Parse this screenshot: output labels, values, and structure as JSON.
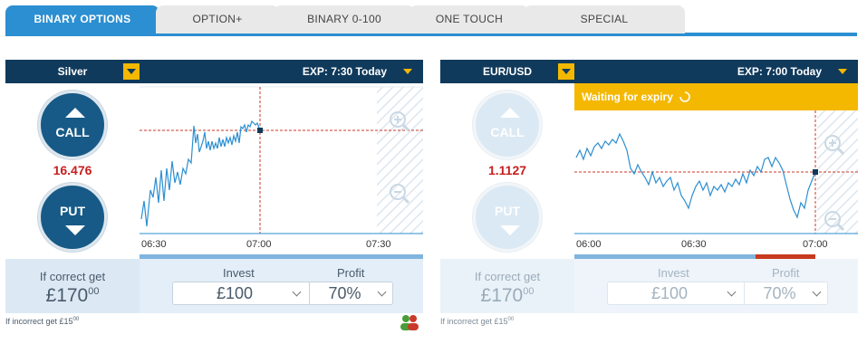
{
  "tabs": [
    {
      "label": "BINARY OPTIONS",
      "active": true
    },
    {
      "label": "OPTION+",
      "active": false
    },
    {
      "label": "BINARY 0-100",
      "active": false
    },
    {
      "label": "ONE TOUCH",
      "active": false
    },
    {
      "label": "SPECIAL",
      "active": false
    }
  ],
  "panels": [
    {
      "asset": "Silver",
      "expiry": "EXP: 7:30 Today",
      "call_label": "CALL",
      "put_label": "PUT",
      "price": "16.476",
      "status": "",
      "x_ticks": [
        "06:30",
        "07:00",
        "07:30"
      ],
      "if_correct_label": "If correct get",
      "if_correct_amount": "£170",
      "if_correct_pence": "00",
      "invest_label": "Invest",
      "invest_value": "£100",
      "profit_label": "Profit",
      "profit_value": "70%",
      "incorrect_text": "If incorrect get £15",
      "incorrect_pence": "00"
    },
    {
      "asset": "EUR/USD",
      "expiry": "EXP: 7:00 Today",
      "call_label": "CALL",
      "put_label": "PUT",
      "price": "1.1127",
      "status": "Waiting for expiry",
      "x_ticks": [
        "06:00",
        "06:30",
        "07:00"
      ],
      "if_correct_label": "If correct get",
      "if_correct_amount": "£170",
      "if_correct_pence": "00",
      "invest_label": "Invest",
      "invest_value": "£100",
      "profit_label": "Profit",
      "profit_value": "70%",
      "incorrect_text": "If incorrect get £15",
      "incorrect_pence": "00"
    }
  ],
  "colors": {
    "tab_active": "#2c8fd1",
    "header": "#103a5c",
    "accent": "#f4b800",
    "price": "#c81e1e",
    "line": "#2c8fd1",
    "expiry_bar": "#c8391e"
  },
  "icons": [
    "chevron-down-icon",
    "zoom-in-icon",
    "zoom-out-icon",
    "spinner-icon",
    "people-icon"
  ]
}
